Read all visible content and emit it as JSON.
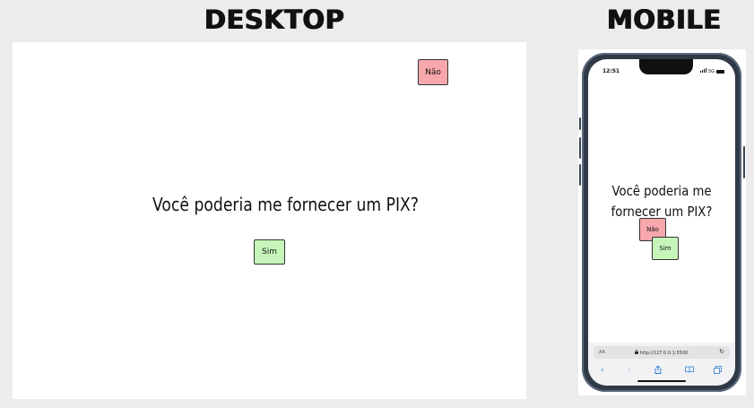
{
  "labels": {
    "desktop": "DESKTOP",
    "mobile": "MOBILE"
  },
  "desktop": {
    "question": "Você poderia me fornecer um PIX?",
    "no_button": "Não",
    "yes_button": "Sim"
  },
  "mobile": {
    "status_time": "12:51",
    "status_network": "5G",
    "question": "Você poderia me fornecer um PIX?",
    "no_button": "Não",
    "yes_button": "Sim",
    "browser": {
      "text_size_label": "AA",
      "url": "http://127.0.0.1:5500"
    }
  },
  "colors": {
    "no_button": "#f7a7ad",
    "yes_button": "#c6f5b9",
    "background": "#ececec"
  },
  "icons": {
    "reload": "reload-icon",
    "back": "chevron-left-icon",
    "forward": "chevron-right-icon",
    "share": "share-icon",
    "bookmarks": "book-icon",
    "tabs": "tabs-icon",
    "lock": "lock-icon",
    "signal": "signal-icon",
    "battery": "battery-icon"
  }
}
